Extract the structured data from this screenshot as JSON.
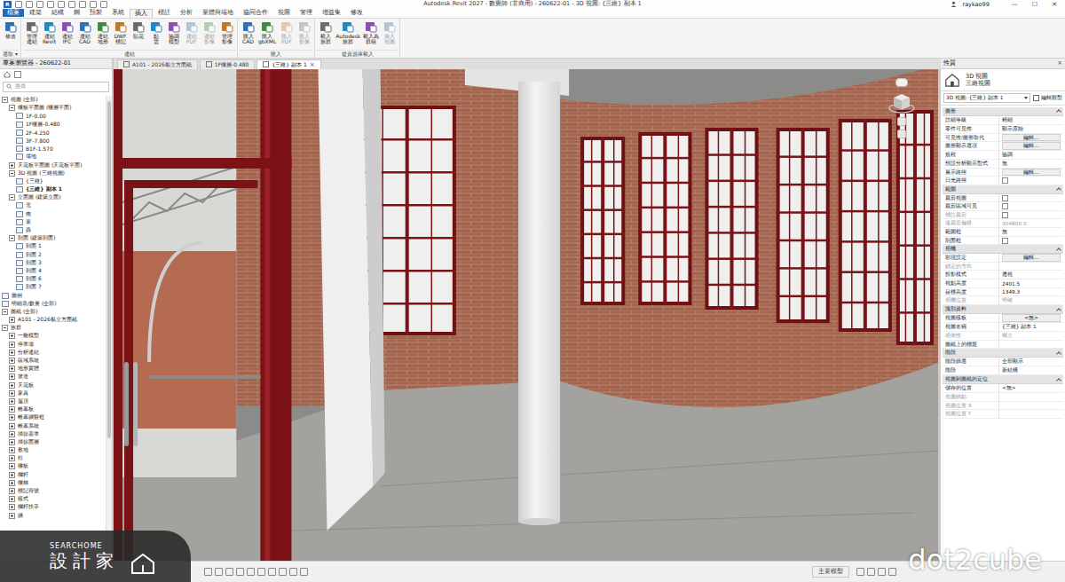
{
  "window": {
    "logo": "R",
    "title": "Autodesk Revit 2027 - 數覺師 (非商用) - 260622-01 - 3D 視圖: {三維} 副本 1",
    "user": "raykao99",
    "controls": [
      "—",
      "☐",
      "✕"
    ]
  },
  "ribbon_tabs": [
    {
      "label": "檔案",
      "kind": "file",
      "selected": false
    },
    {
      "label": "建築",
      "kind": "tab",
      "selected": false
    },
    {
      "label": "結構",
      "kind": "tab",
      "selected": false
    },
    {
      "label": "鋼",
      "kind": "tab",
      "selected": false
    },
    {
      "label": "預製",
      "kind": "tab",
      "selected": false
    },
    {
      "label": "系統",
      "kind": "tab",
      "selected": false
    },
    {
      "label": "插入",
      "kind": "tab",
      "selected": true
    },
    {
      "label": "標註",
      "kind": "tab",
      "selected": false
    },
    {
      "label": "分析",
      "kind": "tab",
      "selected": false
    },
    {
      "label": "量體與場地",
      "kind": "tab",
      "selected": false
    },
    {
      "label": "協同合作",
      "kind": "tab",
      "selected": false
    },
    {
      "label": "視圖",
      "kind": "tab",
      "selected": false
    },
    {
      "label": "管理",
      "kind": "tab",
      "selected": false
    },
    {
      "label": "增益集",
      "kind": "tab",
      "selected": false
    },
    {
      "label": "修改",
      "kind": "tab",
      "selected": false
    }
  ],
  "ribbon_panels": [
    {
      "title": "選取 ▾",
      "buttons": [
        {
          "lines": [
            "修改"
          ],
          "disabled": false
        }
      ]
    },
    {
      "title": "連結",
      "buttons": [
        {
          "lines": [
            "管理",
            "連結"
          ],
          "disabled": false
        },
        {
          "lines": [
            "連結",
            "Revit"
          ],
          "disabled": false
        },
        {
          "lines": [
            "連結",
            "IFC"
          ],
          "disabled": false
        },
        {
          "lines": [
            "連結",
            "CAD"
          ],
          "disabled": false
        },
        {
          "lines": [
            "連結",
            "地形"
          ],
          "disabled": false
        },
        {
          "lines": [
            "DWF",
            "標記"
          ],
          "disabled": false
        },
        {
          "lines": [
            "貼花"
          ],
          "disabled": false
        },
        {
          "lines": [
            "點",
            "雲"
          ],
          "disabled": false
        },
        {
          "lines": [
            "協調",
            "模型"
          ],
          "disabled": false
        },
        {
          "lines": [
            "連結",
            "PDF"
          ],
          "disabled": true
        },
        {
          "lines": [
            "連結",
            "影像"
          ],
          "disabled": true
        },
        {
          "lines": [
            "管理",
            "影像"
          ],
          "disabled": false
        }
      ]
    },
    {
      "title": "匯入",
      "buttons": [
        {
          "lines": [
            "匯入",
            "CAD"
          ],
          "disabled": false
        },
        {
          "lines": [
            "匯入",
            "gbXML"
          ],
          "disabled": false
        },
        {
          "lines": [
            "匯入",
            "PDF"
          ],
          "disabled": true
        },
        {
          "lines": [
            "匯入",
            "影像"
          ],
          "disabled": true
        }
      ]
    },
    {
      "title": "從資源庫載入",
      "buttons": [
        {
          "lines": [
            "載入",
            "族群"
          ],
          "disabled": false
        },
        {
          "lines": [
            "Autodesk",
            "族群"
          ],
          "disabled": false
        },
        {
          "lines": [
            "載入為",
            "群組"
          ],
          "disabled": false
        },
        {
          "lines": [
            "插入",
            "視圖"
          ],
          "disabled": true
        }
      ]
    }
  ],
  "browser": {
    "title": "專案瀏覽器 - 260622-01",
    "search_placeholder": "搜尋",
    "items": [
      {
        "label": "視圖 (全部)",
        "depth": 0,
        "kind": "group",
        "expanded": true,
        "selected": false
      },
      {
        "label": "樓板平面圖 (樓層平面)",
        "depth": 1,
        "kind": "group",
        "expanded": true,
        "selected": false
      },
      {
        "label": "1F-0.00",
        "depth": 2,
        "kind": "view",
        "selected": false
      },
      {
        "label": "1F樓層-0.480",
        "depth": 2,
        "kind": "view",
        "selected": false
      },
      {
        "label": "2F-4.250",
        "depth": 2,
        "kind": "view",
        "selected": false
      },
      {
        "label": "3F-7.800",
        "depth": 2,
        "kind": "view",
        "selected": false
      },
      {
        "label": "B1F-1.570",
        "depth": 2,
        "kind": "view",
        "selected": false
      },
      {
        "label": "場地",
        "depth": 2,
        "kind": "view",
        "selected": false
      },
      {
        "label": "天花板平面圖 (天花板平面)",
        "depth": 1,
        "kind": "group",
        "expanded": false,
        "selected": false
      },
      {
        "label": "3D 視圖 (三維視圖)",
        "depth": 1,
        "kind": "group",
        "expanded": true,
        "selected": false
      },
      {
        "label": "{三維}",
        "depth": 2,
        "kind": "view",
        "selected": false
      },
      {
        "label": "{三維} 副本 1",
        "depth": 2,
        "kind": "view",
        "selected": true
      },
      {
        "label": "立面圖 (建築立面)",
        "depth": 1,
        "kind": "group",
        "expanded": true,
        "selected": false
      },
      {
        "label": "北",
        "depth": 2,
        "kind": "view",
        "selected": false
      },
      {
        "label": "南",
        "depth": 2,
        "kind": "view",
        "selected": false
      },
      {
        "label": "東",
        "depth": 2,
        "kind": "view",
        "selected": false
      },
      {
        "label": "西",
        "depth": 2,
        "kind": "view",
        "selected": false
      },
      {
        "label": "剖面 (建築剖面)",
        "depth": 1,
        "kind": "group",
        "expanded": true,
        "selected": false
      },
      {
        "label": "剖面 1",
        "depth": 2,
        "kind": "view",
        "selected": false
      },
      {
        "label": "剖面 2",
        "depth": 2,
        "kind": "view",
        "selected": false
      },
      {
        "label": "剖面 3",
        "depth": 2,
        "kind": "view",
        "selected": false
      },
      {
        "label": "剖面 4",
        "depth": 2,
        "kind": "view",
        "selected": false
      },
      {
        "label": "剖面 6",
        "depth": 2,
        "kind": "view",
        "selected": false
      },
      {
        "label": "剖面 7",
        "depth": 2,
        "kind": "view",
        "selected": false
      },
      {
        "label": "圖例",
        "depth": 0,
        "kind": "view",
        "selected": false
      },
      {
        "label": "明細表/數量 (全部)",
        "depth": 0,
        "kind": "view",
        "selected": false
      },
      {
        "label": "圖紙 (全部)",
        "depth": 0,
        "kind": "group",
        "expanded": true,
        "selected": false
      },
      {
        "label": "A101 - 2026黏立方面紙",
        "depth": 1,
        "kind": "group",
        "expanded": false,
        "selected": false
      },
      {
        "label": "族群",
        "depth": 0,
        "kind": "group",
        "expanded": true,
        "selected": false
      },
      {
        "label": "一般模型",
        "depth": 1,
        "kind": "group",
        "expanded": false,
        "selected": false
      },
      {
        "label": "停車場",
        "depth": 1,
        "kind": "group",
        "expanded": false,
        "selected": false
      },
      {
        "label": "分析連結",
        "depth": 1,
        "kind": "group",
        "expanded": false,
        "selected": false
      },
      {
        "label": "區域系統",
        "depth": 1,
        "kind": "group",
        "expanded": false,
        "selected": false
      },
      {
        "label": "地形實體",
        "depth": 1,
        "kind": "group",
        "expanded": false,
        "selected": false
      },
      {
        "label": "坡道",
        "depth": 1,
        "kind": "group",
        "expanded": false,
        "selected": false
      },
      {
        "label": "天花板",
        "depth": 1,
        "kind": "group",
        "expanded": false,
        "selected": false
      },
      {
        "label": "家具",
        "depth": 1,
        "kind": "group",
        "expanded": false,
        "selected": false
      },
      {
        "label": "屋頂",
        "depth": 1,
        "kind": "group",
        "expanded": false,
        "selected": false
      },
      {
        "label": "帷幕板",
        "depth": 1,
        "kind": "group",
        "expanded": false,
        "selected": false
      },
      {
        "label": "帷幕牆豎框",
        "depth": 1,
        "kind": "group",
        "expanded": false,
        "selected": false
      },
      {
        "label": "帷幕系統",
        "depth": 1,
        "kind": "group",
        "expanded": false,
        "selected": false
      },
      {
        "label": "掃掠基準",
        "depth": 1,
        "kind": "group",
        "expanded": false,
        "selected": false
      },
      {
        "label": "掃掠面層",
        "depth": 1,
        "kind": "group",
        "expanded": false,
        "selected": false
      },
      {
        "label": "敷地",
        "depth": 1,
        "kind": "group",
        "expanded": false,
        "selected": false
      },
      {
        "label": "柱",
        "depth": 1,
        "kind": "group",
        "expanded": false,
        "selected": false
      },
      {
        "label": "樓板",
        "depth": 1,
        "kind": "group",
        "expanded": false,
        "selected": false
      },
      {
        "label": "欄杆",
        "depth": 1,
        "kind": "group",
        "expanded": false,
        "selected": false
      },
      {
        "label": "樓梯",
        "depth": 1,
        "kind": "group",
        "expanded": false,
        "selected": false
      },
      {
        "label": "標記符號",
        "depth": 1,
        "kind": "group",
        "expanded": false,
        "selected": false
      },
      {
        "label": "樣式",
        "depth": 1,
        "kind": "group",
        "expanded": false,
        "selected": false
      },
      {
        "label": "欄杆扶手",
        "depth": 1,
        "kind": "group",
        "expanded": false,
        "selected": false
      },
      {
        "label": "牆",
        "depth": 1,
        "kind": "group",
        "expanded": false,
        "selected": false
      }
    ]
  },
  "view_tabs": [
    {
      "label": "A101 - 2026黏立方面紙",
      "selected": false
    },
    {
      "label": "1F樓層-0.480",
      "selected": false
    },
    {
      "label": "{三維} 副本 1",
      "selected": true
    }
  ],
  "tab_close": "×",
  "properties": {
    "title": "性質",
    "close": "×",
    "type_name": "3D 視圖",
    "type_sub": "三維視圖",
    "selector": "3D 視圖: {三維} 副本 1",
    "edit_type": "編輯類型",
    "sections": [
      {
        "title": "圖形",
        "rows": [
          {
            "label": "詳細等級",
            "value": "精細",
            "kind": "text",
            "disabled": false
          },
          {
            "label": "零件可見性",
            "value": "顯示原始",
            "kind": "text",
            "disabled": false
          },
          {
            "label": "可見性/圖形取代",
            "value": "編輯...",
            "kind": "button",
            "disabled": false
          },
          {
            "label": "圖形顯示選項",
            "value": "編輯...",
            "kind": "button",
            "disabled": false
          },
          {
            "label": "規程",
            "value": "協調",
            "kind": "text",
            "disabled": false
          },
          {
            "label": "預設分析顯示型式",
            "value": "無",
            "kind": "text",
            "disabled": false
          },
          {
            "label": "展示路徑",
            "value": "編輯...",
            "kind": "button",
            "disabled": false
          },
          {
            "label": "日光路徑",
            "value": "",
            "kind": "check",
            "checked": false,
            "disabled": false
          }
        ]
      },
      {
        "title": "範圍",
        "rows": [
          {
            "label": "裁剪視圖",
            "value": "",
            "kind": "check",
            "checked": false,
            "disabled": false
          },
          {
            "label": "裁剪區域可見",
            "value": "",
            "kind": "check",
            "checked": false,
            "disabled": false
          },
          {
            "label": "標註裁剪",
            "value": "",
            "kind": "check",
            "checked": false,
            "disabled": true
          },
          {
            "label": "遠裁剪偏移",
            "value": "304800.0",
            "kind": "text",
            "disabled": true
          },
          {
            "label": "範圍框",
            "value": "無",
            "kind": "text",
            "disabled": false
          },
          {
            "label": "剖面框",
            "value": "",
            "kind": "check",
            "checked": false,
            "disabled": false
          }
        ]
      },
      {
        "title": "相機",
        "rows": [
          {
            "label": "彩現設定",
            "value": "編輯...",
            "kind": "button",
            "disabled": false
          },
          {
            "label": "鎖定的方向",
            "value": "",
            "kind": "text",
            "disabled": true
          },
          {
            "label": "投影模式",
            "value": "透視",
            "kind": "text",
            "disabled": false
          },
          {
            "label": "視點高度",
            "value": "2401.5",
            "kind": "text",
            "disabled": false
          },
          {
            "label": "目標高度",
            "value": "1349.3",
            "kind": "text",
            "disabled": false
          },
          {
            "label": "相機位置",
            "value": "明確",
            "kind": "text",
            "disabled": true
          }
        ]
      },
      {
        "title": "識別資料",
        "rows": [
          {
            "label": "視圖樣板",
            "value": "<無>",
            "kind": "button",
            "disabled": false
          },
          {
            "label": "視圖名稱",
            "value": "{三維} 副本 1",
            "kind": "text",
            "disabled": false
          },
          {
            "label": "相依性",
            "value": "獨立",
            "kind": "text",
            "disabled": true
          },
          {
            "label": "圖紙上的標題",
            "value": "",
            "kind": "text",
            "disabled": false
          }
        ]
      },
      {
        "title": "階段",
        "rows": [
          {
            "label": "階段篩選",
            "value": "全部顯示",
            "kind": "text",
            "disabled": false
          },
          {
            "label": "階段",
            "value": "新結構",
            "kind": "text",
            "disabled": false
          }
        ]
      },
      {
        "title": "視圖到圖紙的定位",
        "rows": [
          {
            "label": "儲存的位置",
            "value": "<無>",
            "kind": "text",
            "disabled": false
          },
          {
            "label": "視圖錨點",
            "value": "",
            "kind": "text",
            "disabled": true
          },
          {
            "label": "視圖位置 X",
            "value": "",
            "kind": "text",
            "disabled": true
          },
          {
            "label": "視圖位置 Y",
            "value": "",
            "kind": "text",
            "disabled": true
          }
        ]
      }
    ]
  },
  "status_bar": {
    "model": "主要模型"
  },
  "watermarks": {
    "brand_small": "SEARCHOME",
    "brand_main": "設計家",
    "right": "dot2cube"
  }
}
